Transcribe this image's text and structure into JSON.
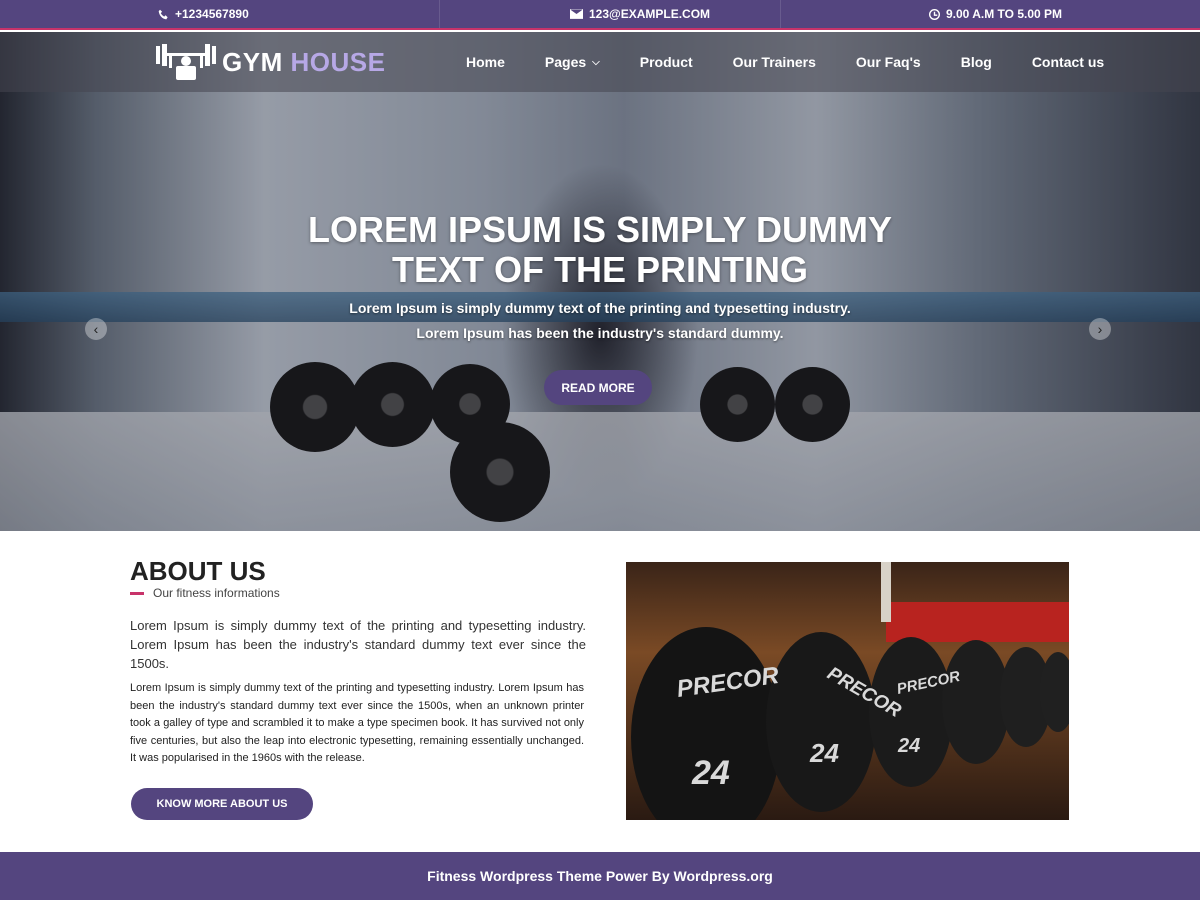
{
  "topbar": {
    "phone": "+1234567890",
    "email": "123@EXAMPLE.COM",
    "hours": "9.00 A.M TO 5.00 PM"
  },
  "brand": {
    "word1": "GYM",
    "word2": "HOUSE"
  },
  "nav": {
    "items": [
      {
        "label": "Home"
      },
      {
        "label": "Pages"
      },
      {
        "label": "Product"
      },
      {
        "label": "Our Trainers"
      },
      {
        "label": "Our Faq's"
      },
      {
        "label": "Blog"
      },
      {
        "label": "Contact us"
      }
    ]
  },
  "hero": {
    "title_line1": "LOREM IPSUM IS SIMPLY DUMMY",
    "title_line2": "TEXT OF THE PRINTING",
    "sub_line1": "Lorem Ipsum is simply dummy text of the printing and typesetting industry.",
    "sub_line2": "Lorem Ipsum has been the industry's standard dummy.",
    "button": "READ MORE"
  },
  "about": {
    "title": "ABOUT US",
    "subtitle": "Our fitness informations",
    "lead": "Lorem Ipsum is simply dummy text of the printing and typesetting industry. Lorem Ipsum has been the industry's standard dummy text ever since the 1500s.",
    "body": "Lorem Ipsum is simply dummy text of the printing and typesetting industry. Lorem Ipsum has been the industry's standard dummy text ever since the 1500s, when an unknown printer took a galley of type and scrambled it to make a type specimen book. It has survived not only five centuries, but also the leap into electronic typesetting, remaining essentially unchanged. It was popularised in the 1960s with the release.",
    "button": "KNOW MORE ABOUT US",
    "photo_labels": {
      "brand": "PRECOR",
      "weight": "24"
    }
  },
  "footer": {
    "text": "Fitness Wordpress Theme Power By Wordpress.org"
  },
  "colors": {
    "primary": "#54457f",
    "accent": "#c8336a",
    "logo_highlight": "#b7a8e6"
  }
}
